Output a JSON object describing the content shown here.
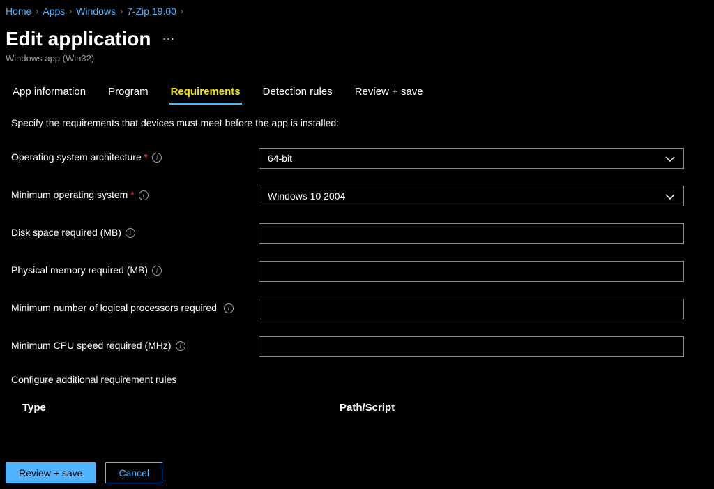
{
  "breadcrumb": {
    "items": [
      {
        "label": "Home"
      },
      {
        "label": "Apps"
      },
      {
        "label": "Windows"
      },
      {
        "label": "7-Zip 19.00"
      }
    ]
  },
  "header": {
    "title": "Edit application",
    "subtitle": "Windows app (Win32)"
  },
  "tabs": [
    {
      "label": "App information",
      "active": false
    },
    {
      "label": "Program",
      "active": false
    },
    {
      "label": "Requirements",
      "active": true
    },
    {
      "label": "Detection rules",
      "active": false
    },
    {
      "label": "Review + save",
      "active": false
    }
  ],
  "content": {
    "intro": "Specify the requirements that devices must meet before the app is installed:",
    "fields": {
      "os_arch": {
        "label": "Operating system architecture",
        "required": true,
        "value": "64-bit"
      },
      "min_os": {
        "label": "Minimum operating system",
        "required": true,
        "value": "Windows 10 2004"
      },
      "disk_space": {
        "label": "Disk space required (MB)",
        "value": ""
      },
      "phys_mem": {
        "label": "Physical memory required (MB)",
        "value": ""
      },
      "min_processors": {
        "label": "Minimum number of logical processors required",
        "value": ""
      },
      "min_cpu_speed": {
        "label": "Minimum CPU speed required (MHz)",
        "value": ""
      }
    },
    "rules_section": "Configure additional requirement rules",
    "table": {
      "col_type": "Type",
      "col_path": "Path/Script"
    }
  },
  "footer": {
    "primary": "Review + save",
    "secondary": "Cancel"
  }
}
